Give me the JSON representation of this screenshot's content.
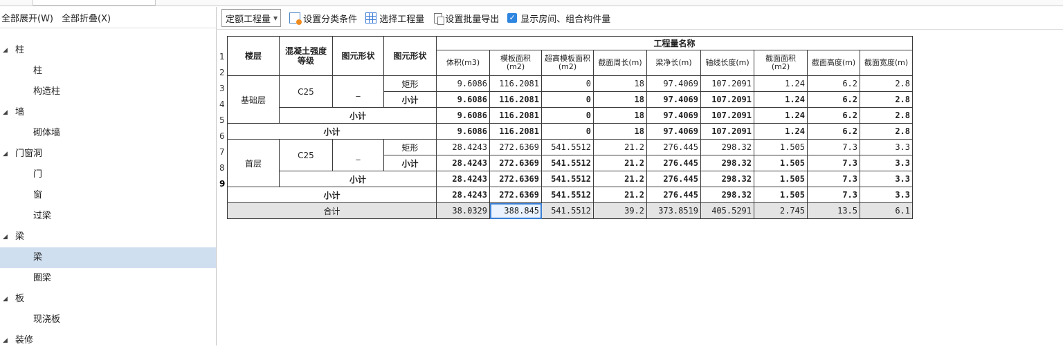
{
  "left_panel": {
    "expand_all": "全部展开(W)",
    "collapse_all": "全部折叠(X)",
    "tree": [
      {
        "label": "柱",
        "level": 0,
        "expanded": true
      },
      {
        "label": "柱",
        "level": 1
      },
      {
        "label": "构造柱",
        "level": 1
      },
      {
        "label": "墙",
        "level": 0,
        "expanded": true
      },
      {
        "label": "砌体墙",
        "level": 1
      },
      {
        "label": "门窗洞",
        "level": 0,
        "expanded": true
      },
      {
        "label": "门",
        "level": 1
      },
      {
        "label": "窗",
        "level": 1
      },
      {
        "label": "过梁",
        "level": 1
      },
      {
        "label": "梁",
        "level": 0,
        "expanded": true
      },
      {
        "label": "梁",
        "level": 1,
        "selected": true
      },
      {
        "label": "圈梁",
        "level": 1
      },
      {
        "label": "板",
        "level": 0,
        "expanded": true
      },
      {
        "label": "现浇板",
        "level": 1
      },
      {
        "label": "装修",
        "level": 0,
        "expanded": true
      }
    ]
  },
  "toolbar": {
    "dropdown_value": "定额工程量",
    "set_category": "设置分类条件",
    "select_quantity": "选择工程量",
    "batch_export": "设置批量导出",
    "show_rooms": "显示房间、组合构件量",
    "show_rooms_checked": true
  },
  "table": {
    "group_header": "工程量名称",
    "col_headers": {
      "floor": "楼层",
      "concrete": "混凝土强度等级",
      "shape1": "图元形状",
      "shape2": "图元形状"
    },
    "sub_headers": [
      "体积(m3)",
      "模板面积(m2)",
      "超高模板面积(m2)",
      "截面周长(m)",
      "梁净长(m)",
      "轴线长度(m)",
      "截面面积(m2)",
      "截面高度(m)",
      "截面宽度(m)"
    ],
    "row_numbers": [
      "1",
      "2",
      "3",
      "4",
      "5",
      "6",
      "7",
      "8",
      "9"
    ],
    "floor1": "基础层",
    "floor2": "首层",
    "concrete1": "C25",
    "concrete2": "C25",
    "dash": "_",
    "rect": "矩形",
    "subtotal": "小计",
    "total": "合计",
    "rows": [
      [
        "9.6086",
        "116.2081",
        "0",
        "18",
        "97.4069",
        "107.2091",
        "1.24",
        "6.2",
        "2.8"
      ],
      [
        "9.6086",
        "116.2081",
        "0",
        "18",
        "97.4069",
        "107.2091",
        "1.24",
        "6.2",
        "2.8"
      ],
      [
        "9.6086",
        "116.2081",
        "0",
        "18",
        "97.4069",
        "107.2091",
        "1.24",
        "6.2",
        "2.8"
      ],
      [
        "9.6086",
        "116.2081",
        "0",
        "18",
        "97.4069",
        "107.2091",
        "1.24",
        "6.2",
        "2.8"
      ],
      [
        "28.4243",
        "272.6369",
        "541.5512",
        "21.2",
        "276.445",
        "298.32",
        "1.505",
        "7.3",
        "3.3"
      ],
      [
        "28.4243",
        "272.6369",
        "541.5512",
        "21.2",
        "276.445",
        "298.32",
        "1.505",
        "7.3",
        "3.3"
      ],
      [
        "28.4243",
        "272.6369",
        "541.5512",
        "21.2",
        "276.445",
        "298.32",
        "1.505",
        "7.3",
        "3.3"
      ],
      [
        "28.4243",
        "272.6369",
        "541.5512",
        "21.2",
        "276.445",
        "298.32",
        "1.505",
        "7.3",
        "3.3"
      ],
      [
        "38.0329",
        "388.845",
        "541.5512",
        "39.2",
        "373.8519",
        "405.5291",
        "2.745",
        "13.5",
        "6.1"
      ]
    ]
  }
}
